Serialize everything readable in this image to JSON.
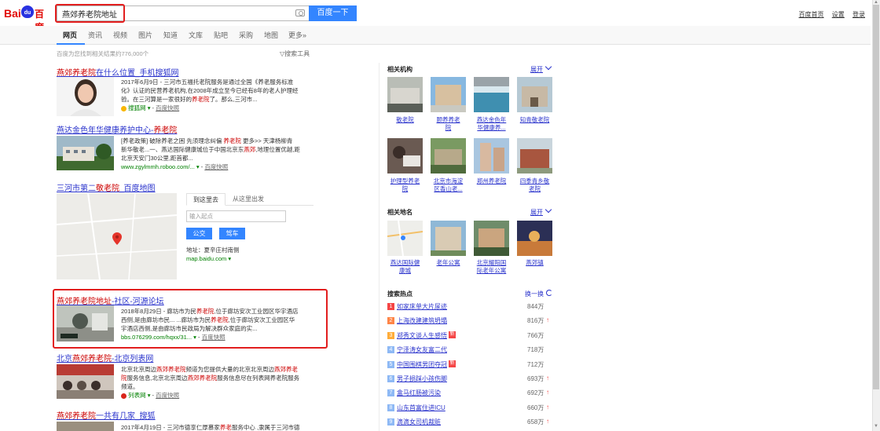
{
  "header": {
    "logo_bai": "Bai",
    "logo_du": "du",
    "logo_cn": "百度",
    "query": "燕郊养老院地址",
    "search_button": "百度一下",
    "links": [
      "百度首页",
      "设置",
      "登录"
    ]
  },
  "tabs": [
    "网页",
    "资讯",
    "视频",
    "图片",
    "知道",
    "文库",
    "贴吧",
    "采购",
    "地图",
    "更多»"
  ],
  "result_count": "百度为您找到相关结果约776,000个",
  "search_tools": "搜索工具",
  "results": {
    "r1": {
      "title_em": "燕郊养老院",
      "title_rest": "在什么位置_手机搜狐网",
      "line1": "2017年6月9日 - 三河市五福托老院服务是通过全国《养老服务标准",
      "line2": "化》认证的民营养老机构,在2008年成立至今已经有8年的老人护理经",
      "line3_pre": "验。在三河算是一家很好的",
      "line3_em": "养老院",
      "line3_post": "了。那么,三河市...",
      "site": "搜狐网",
      "snap": "百度快照"
    },
    "r2": {
      "title_pre": "燕达金色年华健康养护中心-",
      "title_em": "养老院",
      "line1_pre": "[养老政策] 破除养老之困 先须理念纠偏 ",
      "line1_em": "养老院",
      "line1_post": " 更多>> 天津杨柳青",
      "line2_pre": "新华敬老...一、燕达国际健康城位于中国北京东",
      "line2_em": "燕郊",
      "line2_post": ",地理位置优越,距",
      "line3": "北京天安门30公里,距首都...",
      "url": "www.zgylmmh.roboo.com/...",
      "snap": "百度快照"
    },
    "r3": {
      "title_pre": "三河市第二",
      "title_em": "敬老院",
      "title_post": "_百度地图",
      "tab_to": "到这里去",
      "tab_from": "从这里出发",
      "placeholder": "输入起点",
      "bus": "公交",
      "drive": "驾车",
      "address": "地址：夏辛庄村南侧",
      "url": "map.baidu.com"
    },
    "r4": {
      "title_em": "燕郊养老院地址",
      "title_rest": "-社区-河源论坛",
      "line1_pre": "2018年8月29日 - 廊坊市为民",
      "line1_em": "养老院",
      "line1_post": ",位于廊坊安次工业园区华宇酒店",
      "line2_pre": "西侧,是由廊坊市民... ...廊坊市为民",
      "line2_em": "养老院",
      "line2_post": ",位于廊坊安次工业园区华",
      "line3": "宇酒店西侧,是由廊坊市民政局为解决群众家庭的实...",
      "url": "bbs.076299.com/hqxx/31...",
      "snap": "百度快照"
    },
    "r5": {
      "title_pre": "北京",
      "title_em": "燕郊养老院",
      "title_post": "-北京列表网",
      "line1_pre": "北京北京周边",
      "line1_em": "燕郊养老院",
      "line1_mid": "频道为您提供大量的北京北京周边",
      "line1_em2": "燕郊养老",
      "line2_em": "院",
      "line2_pre": "服务信息,北京北京周边",
      "line2_em2": "燕郊养老院",
      "line2_post": "服务信息尽在列表网养老院服务",
      "line3": "频道。",
      "site": "列表网",
      "snap": "百度快照"
    },
    "r6": {
      "title_em": "燕郊养老院",
      "title_rest": "一共有几家_搜狐",
      "line1_pre": "2017年4月19日 - 三河市德享仁厚慕家",
      "line1_em": "养老",
      "line1_post": "服务中心 ,隶属于三河市德"
    }
  },
  "right": {
    "institutions_title": "相关机构",
    "expand": "展开",
    "institutions": [
      [
        "敬老院"
      ],
      [
        "颐养养老",
        "院"
      ],
      [
        "燕达金色年",
        "华健康养..."
      ],
      [
        "知青敬老院"
      ],
      [
        "护理型养老",
        "院"
      ],
      [
        "北京市海淀",
        "区香山老..."
      ],
      [
        "郑州养老院"
      ],
      [
        "四季青乡敬",
        "老院"
      ]
    ],
    "places_title": "相关地名",
    "places": [
      [
        "燕达国际健",
        "康城"
      ],
      [
        "老年公寓"
      ],
      [
        "北京耀阳国",
        "际老年公寓"
      ],
      [
        "燕郊镇"
      ]
    ],
    "hot_title": "搜索热点",
    "hot_refresh": "换一换",
    "hot": [
      {
        "num": "1",
        "text": "如家床单大片尿迹",
        "value": "844万",
        "new": false,
        "up": false
      },
      {
        "num": "2",
        "text": "上海改建建筑坍塌",
        "value": "816万",
        "new": false,
        "up": true
      },
      {
        "num": "3",
        "text": "郑秀文谈人生感悟",
        "value": "766万",
        "new": true,
        "up": false
      },
      {
        "num": "4",
        "text": "宁泽涛女友富二代",
        "value": "718万",
        "new": false,
        "up": false
      },
      {
        "num": "5",
        "text": "中国围棋男团夺冠",
        "value": "712万",
        "new": true,
        "up": false
      },
      {
        "num": "6",
        "text": "男子损踩小孩伤脚",
        "value": "693万",
        "new": false,
        "up": true
      },
      {
        "num": "7",
        "text": "盒马红肠被污染",
        "value": "692万",
        "new": false,
        "up": true
      },
      {
        "num": "8",
        "text": "山东首富住进ICU",
        "value": "660万",
        "new": false,
        "up": true
      },
      {
        "num": "9",
        "text": "滴滴女司机裁赃",
        "value": "658万",
        "new": false,
        "up": true
      }
    ],
    "new_badge": "新",
    "up_arrow": "↑"
  },
  "colors": {
    "link": "#2a33cc",
    "em": "#cc0000",
    "url": "#008000",
    "accent": "#3385ff",
    "highlight_box": "#e21e1e",
    "hot_top": "#f54545",
    "hot_second": "#ff8547",
    "hot_third": "#ffac38",
    "hot_rest": "#8eb9f5"
  }
}
